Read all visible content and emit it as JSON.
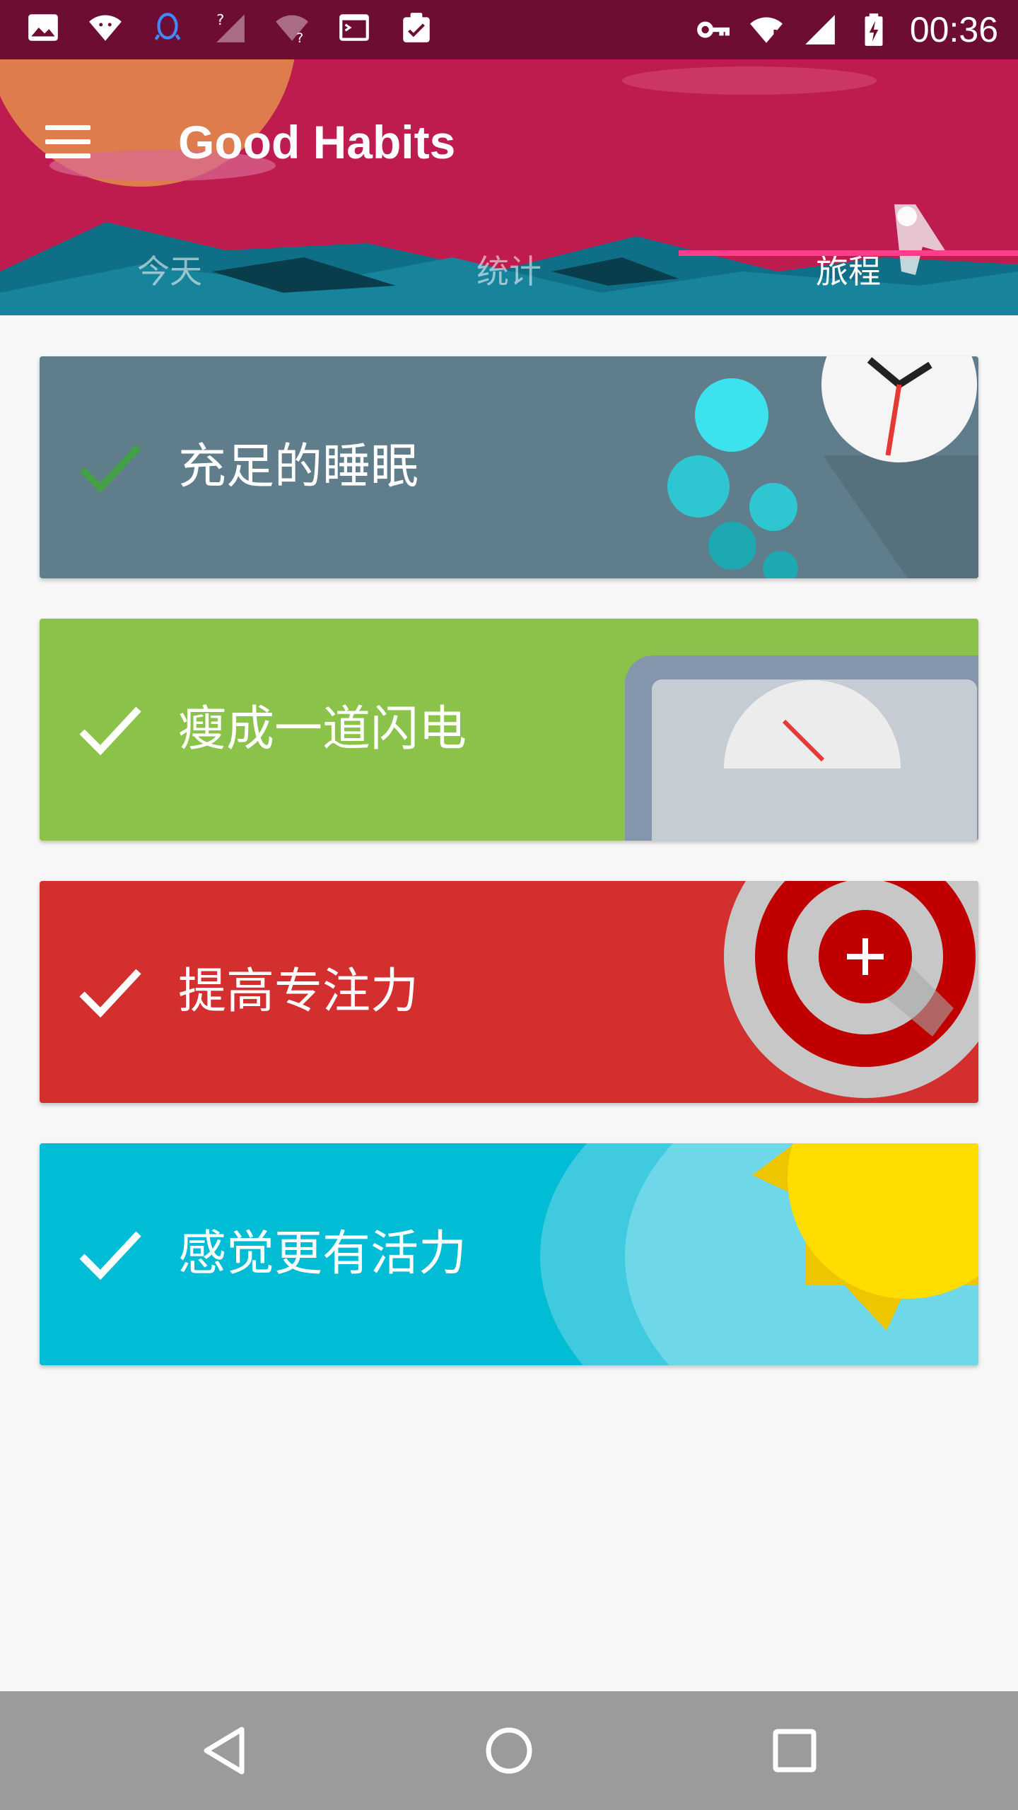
{
  "status_bar": {
    "time": "00:36",
    "left_icons": [
      "image-icon",
      "android-wifi-icon",
      "qq-icon",
      "signal-unknown-icon",
      "wifi-unknown-icon",
      "terminal-icon",
      "clipboard-check-icon"
    ],
    "right_icons": [
      "vpn-key-icon",
      "wifi-alert-icon",
      "cell-signal-icon",
      "battery-charging-icon"
    ]
  },
  "header": {
    "title": "Good Habits",
    "colors": {
      "primary": "#be1b4f",
      "status": "#6e0d33",
      "indicator": "#ff3d8b"
    },
    "tabs": [
      {
        "label": "今天",
        "active": false
      },
      {
        "label": "统计",
        "active": false
      },
      {
        "label": "旅程",
        "active": true
      }
    ]
  },
  "habits": [
    {
      "label": "充足的睡眠",
      "color": "#607d8b",
      "check_color": "#43a047",
      "art": "clock-icon"
    },
    {
      "label": "瘦成一道闪电",
      "color": "#8bc34a",
      "check_color": "#ffffff",
      "art": "scale-icon"
    },
    {
      "label": "提高专注力",
      "color": "#d32f2f",
      "check_color": "#ffffff",
      "art": "target-icon"
    },
    {
      "label": "感觉更有活力",
      "color": "#00bcd4",
      "check_color": "#ffffff",
      "art": "sun-icon"
    }
  ],
  "nav_bar": {
    "buttons": [
      "back-icon",
      "home-icon",
      "recents-icon"
    ]
  }
}
